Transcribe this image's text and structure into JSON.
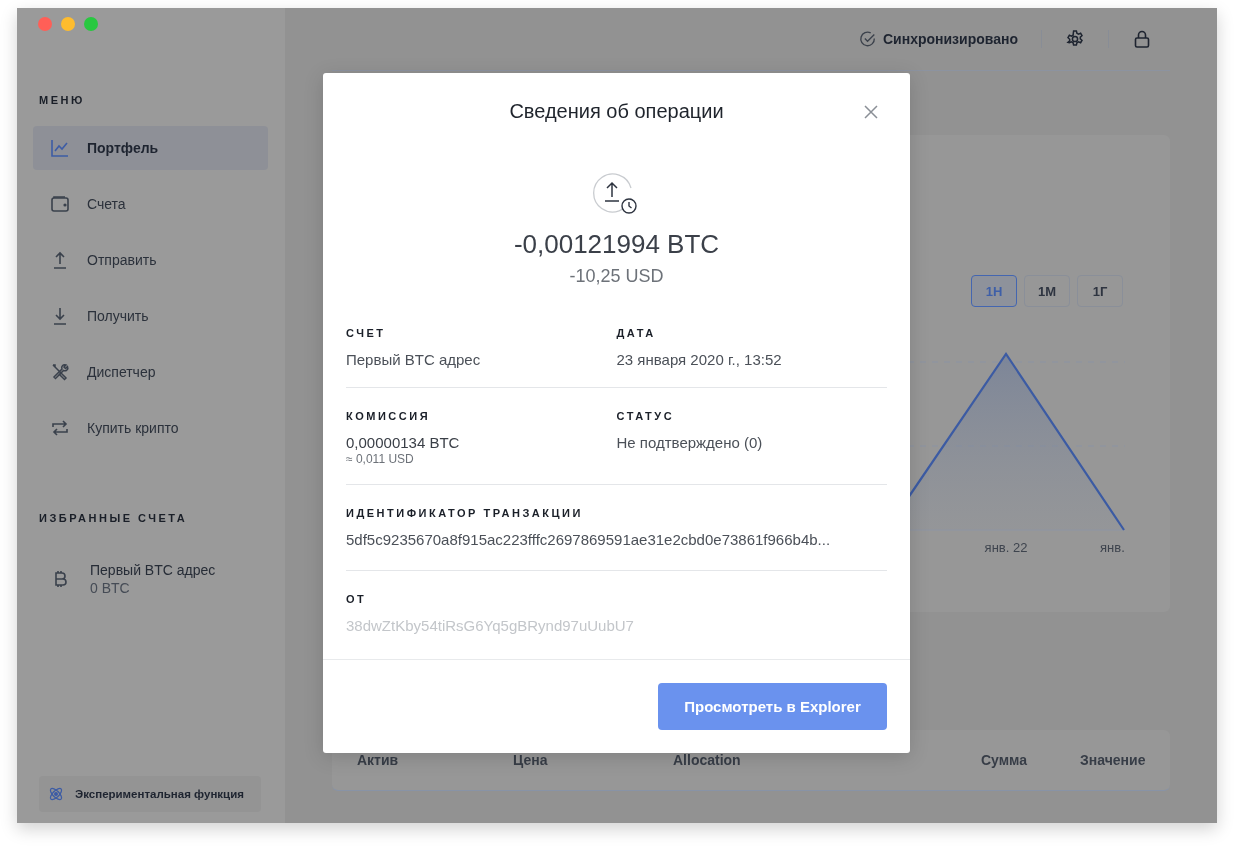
{
  "sidebar": {
    "menu_heading": "МЕНЮ",
    "items": [
      {
        "label": "Портфель",
        "selected": true
      },
      {
        "label": "Счета",
        "selected": false
      },
      {
        "label": "Отправить",
        "selected": false
      },
      {
        "label": "Получить",
        "selected": false
      },
      {
        "label": "Диспетчер",
        "selected": false
      },
      {
        "label": "Купить крипто",
        "selected": false
      }
    ],
    "favorites_heading": "ИЗБРАННЫЕ СЧЕТА",
    "favorites": [
      {
        "name": "Первый BTC адрес",
        "balance": "0 BTC"
      }
    ],
    "experimental_button": "Экспериментальная функция"
  },
  "topbar": {
    "sync_status": "Синхронизировано"
  },
  "chart": {
    "range_buttons": [
      {
        "label": "1Н",
        "selected": true
      },
      {
        "label": "1М",
        "selected": false
      },
      {
        "label": "1Г",
        "selected": false
      }
    ],
    "x_labels": [
      "янв. 22",
      "янв."
    ]
  },
  "table": {
    "columns": [
      "Актив",
      "Цена",
      "Allocation",
      "Сумма",
      "Значение"
    ]
  },
  "modal": {
    "title": "Сведения об операции",
    "amount": "-0,00121994 BTC",
    "amount_fiat": "-10,25 USD",
    "account": {
      "label": "СЧЕТ",
      "value": "Первый BTC адрес"
    },
    "date": {
      "label": "ДАТА",
      "value": "23 января 2020 г., 13:52"
    },
    "fee": {
      "label": "КОМИССИЯ",
      "value": "0,00000134 BTC",
      "fiat": "≈ 0,011 USD"
    },
    "status": {
      "label": "СТАТУС",
      "value": "Не подтверждено (0)"
    },
    "transaction_id": {
      "label": "ИДЕНТИФИКАТОР ТРАНЗАКЦИИ",
      "value": "5df5c9235670a8f915ac223fffc2697869591ae31e2cbd0e73861f966b4b..."
    },
    "from": {
      "label": "ОТ",
      "value": "38dwZtKby54tiRsG6Yq5gBRynd97uUubU7"
    },
    "button": "Просмотреть в Explorer"
  }
}
